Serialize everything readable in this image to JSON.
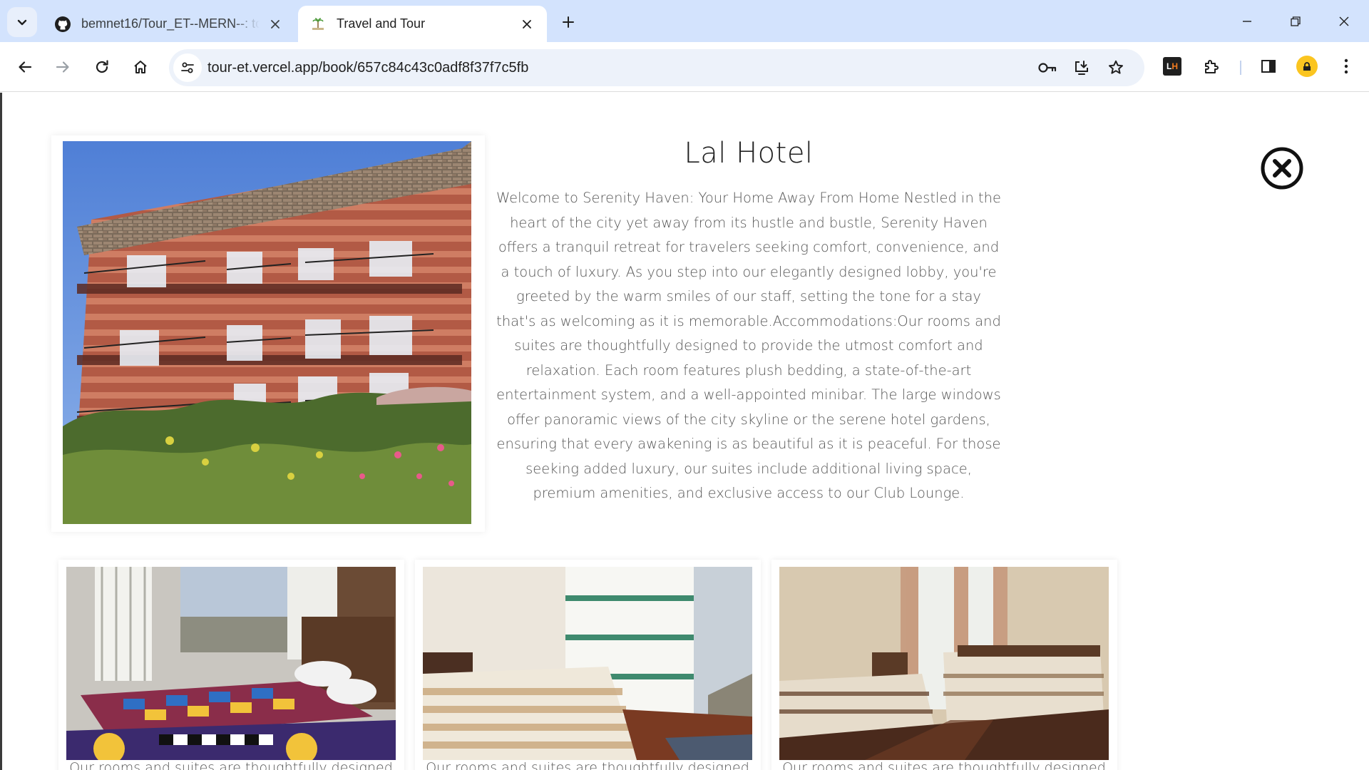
{
  "browser": {
    "tabs": [
      {
        "title": "bemnet16/Tour_ET--MERN--: to",
        "favicon": "github-icon",
        "active": false
      },
      {
        "title": "Travel and Tour",
        "favicon": "palm-tree-icon",
        "active": true
      }
    ],
    "url": "tour-et.vercel.app/book/657c84c43c0adf8f37f7c5fb",
    "colors": {
      "tabstrip": "#d3e3fd",
      "omnibox": "#edf2fa",
      "profile": "#fbc520"
    }
  },
  "page": {
    "hotel": {
      "name": "Lal Hotel",
      "description": "Welcome to Serenity Haven: Your Home Away From Home Nestled in the heart of the city yet away from its hustle and bustle, Serenity Haven offers a tranquil retreat for travelers seeking comfort, convenience, and a touch of luxury. As you step into our elegantly designed lobby, you're greeted by the warm smiles of our staff, setting the tone for a stay that's as welcoming as it is memorable.Accommodations:Our rooms and suites are thoughtfully designed to provide the utmost comfort and relaxation. Each room features plush bedding, a state-of-the-art entertainment system, and a well-appointed minibar. The large windows offer panoramic views of the city skyline or the serene hotel gardens, ensuring that every awakening is as beautiful as it is peaceful. For those seeking added luxury, our suites include additional living space, premium amenities, and exclusive access to our Club Lounge."
    },
    "rooms": [
      {
        "caption": "Our rooms and suites are thoughtfully designed"
      },
      {
        "caption": "Our rooms and suites are thoughtfully designed"
      },
      {
        "caption": "Our rooms and suites are thoughtfully designed"
      }
    ]
  }
}
